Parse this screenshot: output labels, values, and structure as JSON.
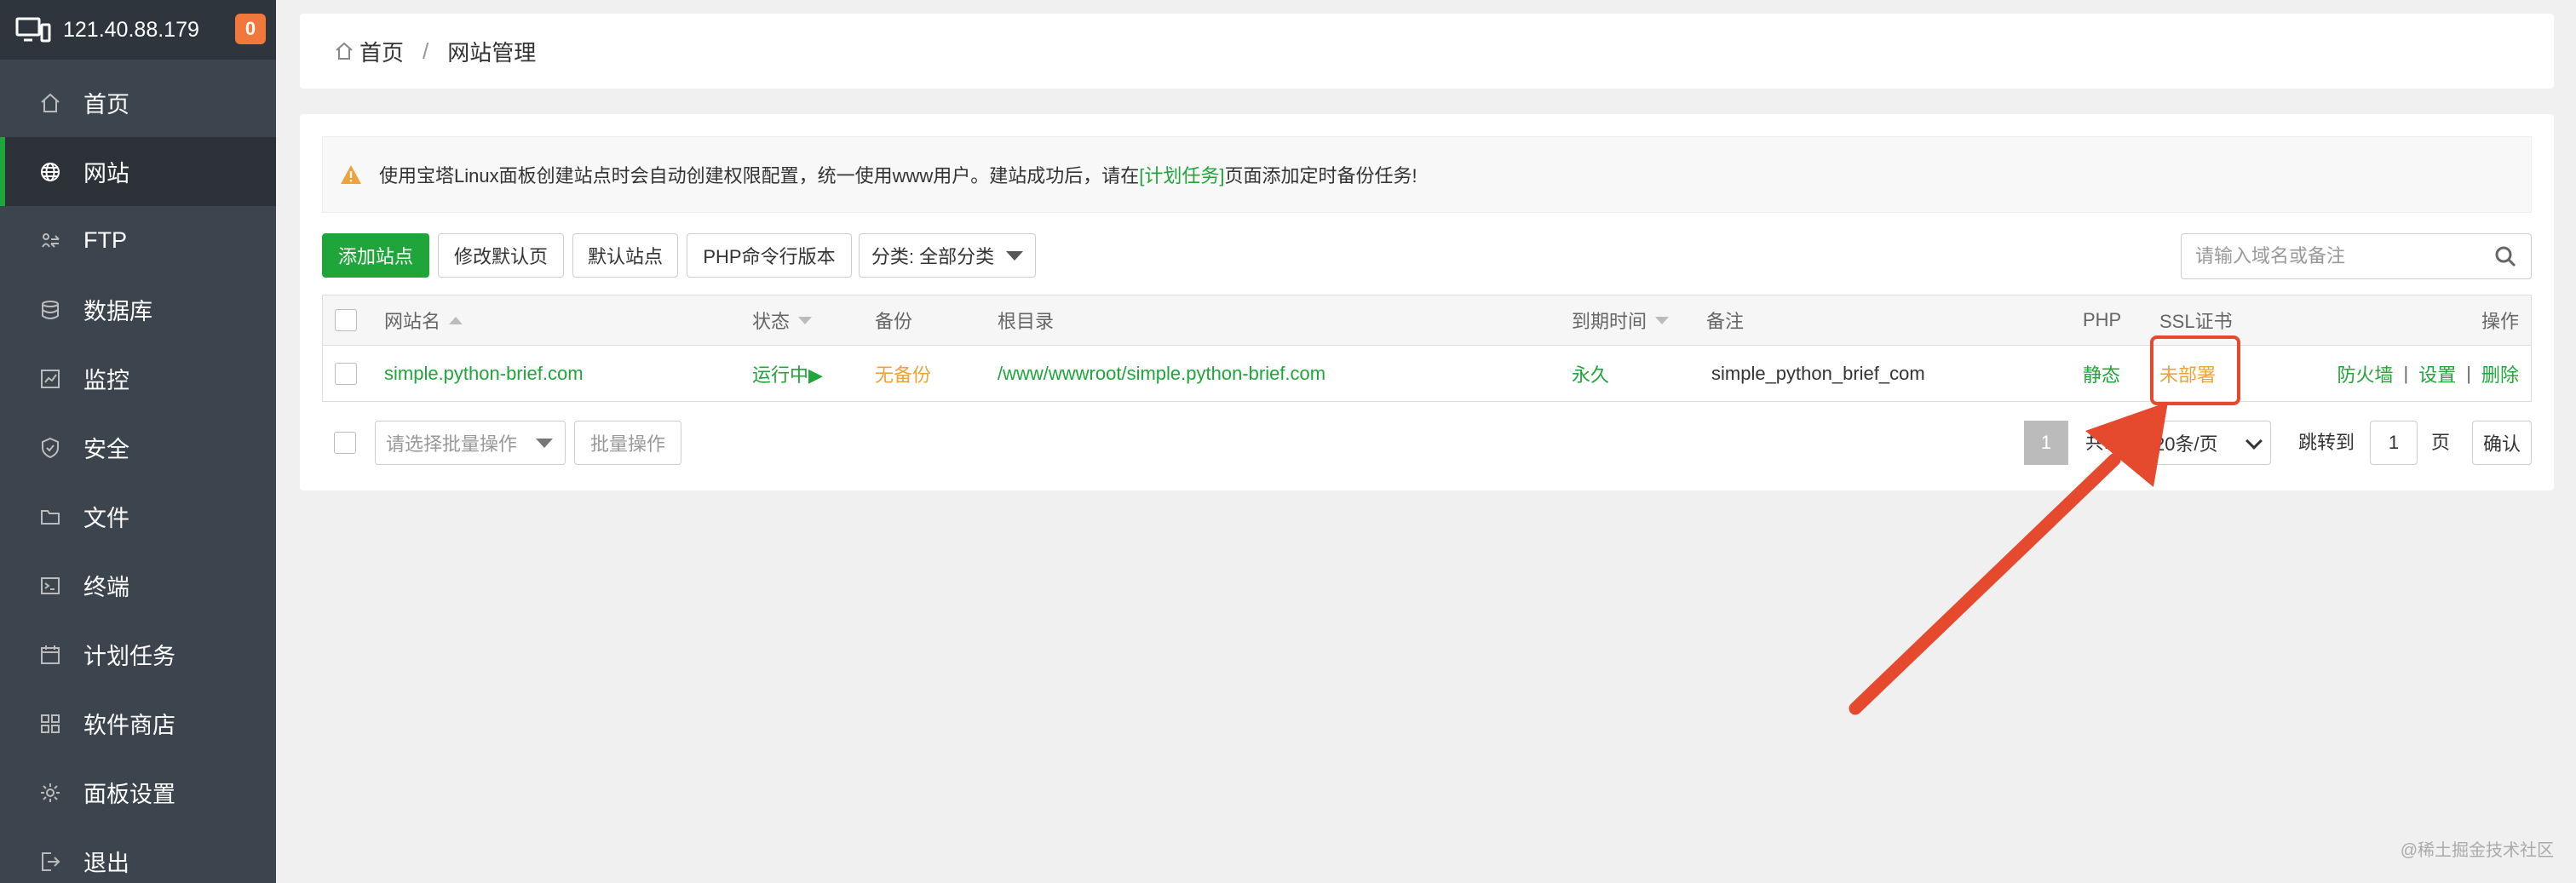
{
  "sidebar": {
    "server_ip": "121.40.88.179",
    "notice_count": "0",
    "items": [
      {
        "label": "首页",
        "icon": "home-icon"
      },
      {
        "label": "网站",
        "icon": "globe-icon",
        "active": true
      },
      {
        "label": "FTP",
        "icon": "ftp-icon"
      },
      {
        "label": "数据库",
        "icon": "database-icon"
      },
      {
        "label": "监控",
        "icon": "monitor-chart-icon"
      },
      {
        "label": "安全",
        "icon": "shield-icon"
      },
      {
        "label": "文件",
        "icon": "folder-icon"
      },
      {
        "label": "终端",
        "icon": "terminal-icon"
      },
      {
        "label": "计划任务",
        "icon": "calendar-icon"
      },
      {
        "label": "软件商店",
        "icon": "apps-grid-icon"
      },
      {
        "label": "面板设置",
        "icon": "gear-icon"
      },
      {
        "label": "退出",
        "icon": "logout-icon"
      }
    ]
  },
  "breadcrumb": {
    "home": "首页",
    "separator": "/",
    "current": "网站管理"
  },
  "alert": {
    "before": "使用宝塔Linux面板创建站点时会自动创建权限配置，统一使用www用户。建站成功后，请在",
    "link": "[计划任务]",
    "after": "页面添加定时备份任务!"
  },
  "toolbar": {
    "add_site": "添加站点",
    "edit_default_page": "修改默认页",
    "default_site": "默认站点",
    "php_cli_version": "PHP命令行版本",
    "category": "分类: 全部分类",
    "search_placeholder": "请输入域名或备注"
  },
  "table": {
    "headers": {
      "site_name": "网站名",
      "status": "状态",
      "backup": "备份",
      "root_dir": "根目录",
      "expire": "到期时间",
      "remark": "备注",
      "php": "PHP",
      "ssl": "SSL证书",
      "actions": "操作"
    },
    "rows": [
      {
        "site_name": "simple.python-brief.com",
        "status": "运行中▶",
        "backup": "无备份",
        "root_dir": "/www/wwwroot/simple.python-brief.com",
        "expire": "永久",
        "remark": "simple_python_brief_com",
        "php": "静态",
        "ssl": "未部署",
        "actions": {
          "firewall": "防火墙",
          "settings": "设置",
          "delete": "删除",
          "sep": "|"
        }
      }
    ]
  },
  "footer": {
    "bulk_placeholder": "请选择批量操作",
    "bulk_button": "批量操作",
    "current_page": "1",
    "total_prefix": "共1",
    "per_page": "20条/页",
    "jump_label": "跳转到",
    "jump_value": "1",
    "page_unit": "页",
    "confirm": "确认"
  },
  "watermark": "@稀土掘金技术社区",
  "colors": {
    "accent": "#20a53a",
    "warning": "#f0a23a",
    "highlight": "#e64a2e",
    "sidebar_bg": "#3c444d"
  }
}
